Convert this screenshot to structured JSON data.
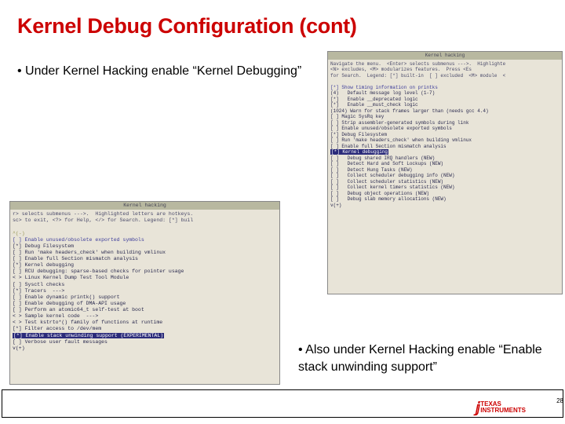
{
  "title": "Kernel Debug Configuration (cont)",
  "bullets": {
    "b1": "Under Kernel Hacking enable “Kernel Debugging”",
    "b2": "Also under Kernel Hacking enable “Enable stack unwinding support”"
  },
  "left_term": {
    "header": "Kernel hacking",
    "help1": "r> selects submenus --->.  Highlighted letters are hotkeys.",
    "help2": "sc> to exit, <?> for Help, </> for Search. Legend: [*] buil",
    "scroll_up": "^(-)",
    "lines": [
      "[ ] Enable unused/obsolete exported symbols",
      "[*] Debug Filesystem",
      "[ ] Run 'make headers_check' when building vmlinux",
      "[ ] Enable full Section mismatch analysis",
      "[*] Kernel debugging",
      "[ ] RCU debugging: sparse-based checks for pointer usage",
      "< > Linux Kernel Dump Test Tool Module",
      "[ ] Sysctl checks",
      "[*] Tracers  --->",
      "[ ] Enable dynamic printk() support",
      "[ ] Enable debugging of DMA-API usage",
      "[ ] Perform an atomic64_t self-test at boot",
      "< > Sample kernel code  --->",
      "< > Test kstrto*() family of functions at runtime",
      "[*] Filter access to /dev/mem"
    ],
    "highlighted": "[*] Enable stack unwinding support (EXPERIMENTAL)",
    "after": "[ ] Verbose user fault messages",
    "scroll_dn": "v(+)"
  },
  "right_term": {
    "header": "Kernel hacking",
    "help1": "Navigate the menu.  <Enter> selects submenus --->.  Highlighte",
    "help2": "<N> excludes, <M> modularizes features.  Press <Es",
    "help3": "for Search.  Legend: [*] built-in  [ ] excluded  <M> module  <",
    "lines_a": [
      "[*] Show timing information on printks",
      "(4)   Default message log level (1-7)",
      "[*]   Enable __deprecated logic",
      "[*]   Enable __must_check logic",
      "(1024) Warn for stack frames larger than (needs gcc 4.4)",
      "[ ] Magic SysRq key",
      "[ ] Strip assembler-generated symbols during link",
      "[ ] Enable unused/obsolete exported symbols",
      "[*] Debug Filesystem",
      "[ ] Run 'make headers_check' when building vmlinux",
      "[ ] Enable full Section mismatch analysis"
    ],
    "highlighted": "[*] Kernel debugging",
    "lines_b": [
      "[ ]   Debug shared IRQ handlers (NEW)",
      "[ ]   Detect Hard and Soft Lockups (NEW)",
      "[ ]   Detect Hung Tasks (NEW)",
      "[ ]   Collect scheduler debugging info (NEW)",
      "[ ]   Collect scheduler statistics (NEW)",
      "[ ]   Collect kernel timers statistics (NEW)",
      "[ ]   Debug object operations (NEW)",
      "[ ]   Debug slab memory allocations (NEW)"
    ],
    "scroll_dn": "v(+)"
  },
  "footer": {
    "ti_text1": "TEXAS",
    "ti_text2": "INSTRUMENTS",
    "page": "28"
  }
}
